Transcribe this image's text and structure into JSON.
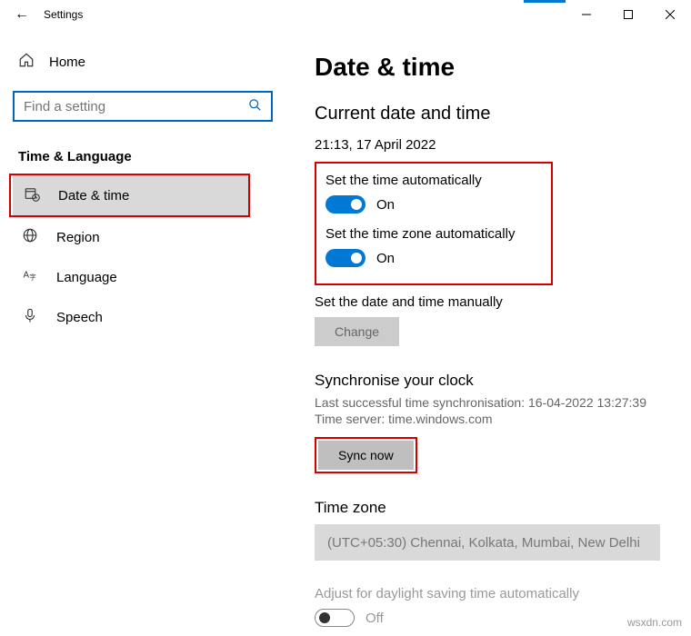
{
  "window": {
    "title": "Settings"
  },
  "sidebar": {
    "home": "Home",
    "search_placeholder": "Find a setting",
    "category": "Time & Language",
    "items": [
      {
        "label": "Date & time"
      },
      {
        "label": "Region"
      },
      {
        "label": "Language"
      },
      {
        "label": "Speech"
      }
    ]
  },
  "page": {
    "title": "Date & time",
    "subtitle": "Current date and time",
    "current": "21:13, 17 April 2022",
    "auto_time": {
      "label": "Set the time automatically",
      "state": "On"
    },
    "auto_tz": {
      "label": "Set the time zone automatically",
      "state": "On"
    },
    "manual": {
      "label": "Set the date and time manually",
      "button": "Change"
    },
    "sync": {
      "heading": "Synchronise your clock",
      "last": "Last successful time synchronisation: 16-04-2022 13:27:39",
      "server": "Time server: time.windows.com",
      "button": "Sync now"
    },
    "timezone": {
      "heading": "Time zone",
      "value": "(UTC+05:30) Chennai, Kolkata, Mumbai, New Delhi"
    },
    "dst": {
      "label": "Adjust for daylight saving time automatically",
      "state": "Off"
    }
  },
  "watermark": "wsxdn.com"
}
